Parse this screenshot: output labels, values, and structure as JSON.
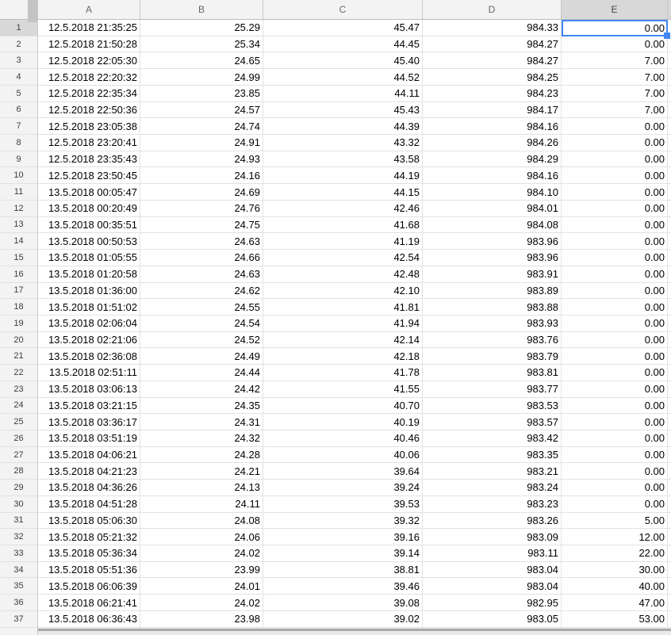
{
  "sheet": {
    "columns": [
      "A",
      "B",
      "C",
      "D",
      "E"
    ],
    "selection": {
      "active_cell": "E1",
      "column": "E",
      "row": 1
    },
    "colors": {
      "selection_blue": "#4285f4",
      "header_bg": "#f3f3f3",
      "selected_header_bg": "#d8d8d8",
      "gridline": "#e2e2e2",
      "header_border": "#c6c6c6"
    },
    "rows": [
      {
        "n": "1",
        "cells": [
          "12.5.2018 21:35:25",
          "25.29",
          "45.47",
          "984.33",
          "0.00"
        ]
      },
      {
        "n": "2",
        "cells": [
          "12.5.2018 21:50:28",
          "25.34",
          "44.45",
          "984.27",
          "0.00"
        ]
      },
      {
        "n": "3",
        "cells": [
          "12.5.2018 22:05:30",
          "24.65",
          "45.40",
          "984.27",
          "7.00"
        ]
      },
      {
        "n": "4",
        "cells": [
          "12.5.2018 22:20:32",
          "24.99",
          "44.52",
          "984.25",
          "7.00"
        ]
      },
      {
        "n": "5",
        "cells": [
          "12.5.2018 22:35:34",
          "23.85",
          "44.11",
          "984.23",
          "7.00"
        ]
      },
      {
        "n": "6",
        "cells": [
          "12.5.2018 22:50:36",
          "24.57",
          "45.43",
          "984.17",
          "7.00"
        ]
      },
      {
        "n": "7",
        "cells": [
          "12.5.2018 23:05:38",
          "24.74",
          "44.39",
          "984.16",
          "0.00"
        ]
      },
      {
        "n": "8",
        "cells": [
          "12.5.2018 23:20:41",
          "24.91",
          "43.32",
          "984.26",
          "0.00"
        ]
      },
      {
        "n": "9",
        "cells": [
          "12.5.2018 23:35:43",
          "24.93",
          "43.58",
          "984.29",
          "0.00"
        ]
      },
      {
        "n": "10",
        "cells": [
          "12.5.2018 23:50:45",
          "24.16",
          "44.19",
          "984.16",
          "0.00"
        ]
      },
      {
        "n": "11",
        "cells": [
          "13.5.2018 00:05:47",
          "24.69",
          "44.15",
          "984.10",
          "0.00"
        ]
      },
      {
        "n": "12",
        "cells": [
          "13.5.2018 00:20:49",
          "24.76",
          "42.46",
          "984.01",
          "0.00"
        ]
      },
      {
        "n": "13",
        "cells": [
          "13.5.2018 00:35:51",
          "24.75",
          "41.68",
          "984.08",
          "0.00"
        ]
      },
      {
        "n": "14",
        "cells": [
          "13.5.2018 00:50:53",
          "24.63",
          "41.19",
          "983.96",
          "0.00"
        ]
      },
      {
        "n": "15",
        "cells": [
          "13.5.2018 01:05:55",
          "24.66",
          "42.54",
          "983.96",
          "0.00"
        ]
      },
      {
        "n": "16",
        "cells": [
          "13.5.2018 01:20:58",
          "24.63",
          "42.48",
          "983.91",
          "0.00"
        ]
      },
      {
        "n": "17",
        "cells": [
          "13.5.2018 01:36:00",
          "24.62",
          "42.10",
          "983.89",
          "0.00"
        ]
      },
      {
        "n": "18",
        "cells": [
          "13.5.2018 01:51:02",
          "24.55",
          "41.81",
          "983.88",
          "0.00"
        ]
      },
      {
        "n": "19",
        "cells": [
          "13.5.2018 02:06:04",
          "24.54",
          "41.94",
          "983.93",
          "0.00"
        ]
      },
      {
        "n": "20",
        "cells": [
          "13.5.2018 02:21:06",
          "24.52",
          "42.14",
          "983.76",
          "0.00"
        ]
      },
      {
        "n": "21",
        "cells": [
          "13.5.2018 02:36:08",
          "24.49",
          "42.18",
          "983.79",
          "0.00"
        ]
      },
      {
        "n": "22",
        "cells": [
          "13.5.2018 02:51:11",
          "24.44",
          "41.78",
          "983.81",
          "0.00"
        ]
      },
      {
        "n": "23",
        "cells": [
          "13.5.2018 03:06:13",
          "24.42",
          "41.55",
          "983.77",
          "0.00"
        ]
      },
      {
        "n": "24",
        "cells": [
          "13.5.2018 03:21:15",
          "24.35",
          "40.70",
          "983.53",
          "0.00"
        ]
      },
      {
        "n": "25",
        "cells": [
          "13.5.2018 03:36:17",
          "24.31",
          "40.19",
          "983.57",
          "0.00"
        ]
      },
      {
        "n": "26",
        "cells": [
          "13.5.2018 03:51:19",
          "24.32",
          "40.46",
          "983.42",
          "0.00"
        ]
      },
      {
        "n": "27",
        "cells": [
          "13.5.2018 04:06:21",
          "24.28",
          "40.06",
          "983.35",
          "0.00"
        ]
      },
      {
        "n": "28",
        "cells": [
          "13.5.2018 04:21:23",
          "24.21",
          "39.64",
          "983.21",
          "0.00"
        ]
      },
      {
        "n": "29",
        "cells": [
          "13.5.2018 04:36:26",
          "24.13",
          "39.24",
          "983.24",
          "0.00"
        ]
      },
      {
        "n": "30",
        "cells": [
          "13.5.2018 04:51:28",
          "24.11",
          "39.53",
          "983.23",
          "0.00"
        ]
      },
      {
        "n": "31",
        "cells": [
          "13.5.2018 05:06:30",
          "24.08",
          "39.32",
          "983.26",
          "5.00"
        ]
      },
      {
        "n": "32",
        "cells": [
          "13.5.2018 05:21:32",
          "24.06",
          "39.16",
          "983.09",
          "12.00"
        ]
      },
      {
        "n": "33",
        "cells": [
          "13.5.2018 05:36:34",
          "24.02",
          "39.14",
          "983.11",
          "22.00"
        ]
      },
      {
        "n": "34",
        "cells": [
          "13.5.2018 05:51:36",
          "23.99",
          "38.81",
          "983.04",
          "30.00"
        ]
      },
      {
        "n": "35",
        "cells": [
          "13.5.2018 06:06:39",
          "24.01",
          "39.46",
          "983.04",
          "40.00"
        ]
      },
      {
        "n": "36",
        "cells": [
          "13.5.2018 06:21:41",
          "24.02",
          "39.08",
          "982.95",
          "47.00"
        ]
      },
      {
        "n": "37",
        "cells": [
          "13.5.2018 06:36:43",
          "23.98",
          "39.02",
          "983.05",
          "53.00"
        ]
      }
    ]
  }
}
